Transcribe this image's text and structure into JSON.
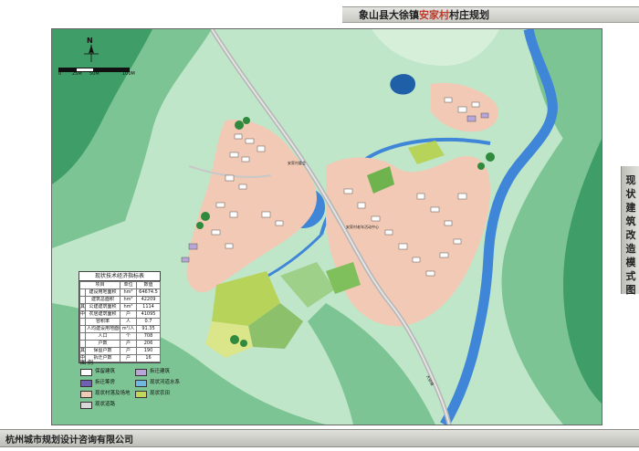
{
  "header": {
    "title_prefix": "象山县大徐镇",
    "title_highlight": "安家村",
    "title_suffix": "村庄规划"
  },
  "sidebar": {
    "title": "现状建筑改造模式图"
  },
  "footer": {
    "company": "杭州城市规划设计咨询有限公司"
  },
  "compass": {
    "label": "N"
  },
  "scale": {
    "labels": [
      "0",
      "25M",
      "50M",
      "100M"
    ]
  },
  "map_labels": [
    {
      "text": "安家村委会"
    },
    {
      "text": "安家村老年活动中心"
    },
    {
      "text": "大徐镇"
    }
  ],
  "stats_table": {
    "caption": "现状技术经济指标表",
    "header": [
      "项目",
      "单位",
      "数值"
    ],
    "rows": [
      [
        "",
        "建设用地面积",
        "hm²",
        "64674.5"
      ],
      [
        "",
        "建筑总面积",
        "hm²",
        "42209"
      ],
      [
        "其",
        "公建建筑面积",
        "hm²",
        "1114"
      ],
      [
        "中",
        "农居建筑面积",
        "户",
        "41095"
      ],
      [
        "",
        "容积率",
        "人",
        "0.7"
      ],
      [
        "",
        "人均建设用地面积",
        "m²/人",
        "91.35"
      ],
      [
        "",
        "人口",
        "个",
        "708"
      ],
      [
        "",
        "户数",
        "户",
        "206"
      ],
      [
        "其",
        "保留户数",
        "户",
        "190"
      ],
      [
        "中",
        "拆迁户数",
        "户",
        "16"
      ]
    ]
  },
  "legend": {
    "title": "图  例",
    "items": [
      {
        "label": "保留建筑",
        "color": "#ffffff"
      },
      {
        "label": "拆迁建筑",
        "color": "#b9a6d8"
      },
      {
        "label": "拆迁筹房",
        "color": "#6f5fb5"
      },
      {
        "label": "现状河道水系",
        "color": "#6db9e0"
      },
      {
        "label": "现状村落及场地",
        "color": "#f2c9b5"
      },
      {
        "label": "现状农田",
        "color": "#c2d65a"
      },
      {
        "label": "现状道路",
        "color": "#d8d8d8"
      }
    ]
  },
  "colors": {
    "terrain_dark": "#3f9e67",
    "terrain_mid": "#7cc493",
    "terrain_light": "#bfe6c8",
    "village": "#f2c9b5",
    "water": "#3f86d8",
    "road": "#c8c8c8",
    "farmland": "#b7d35a"
  }
}
